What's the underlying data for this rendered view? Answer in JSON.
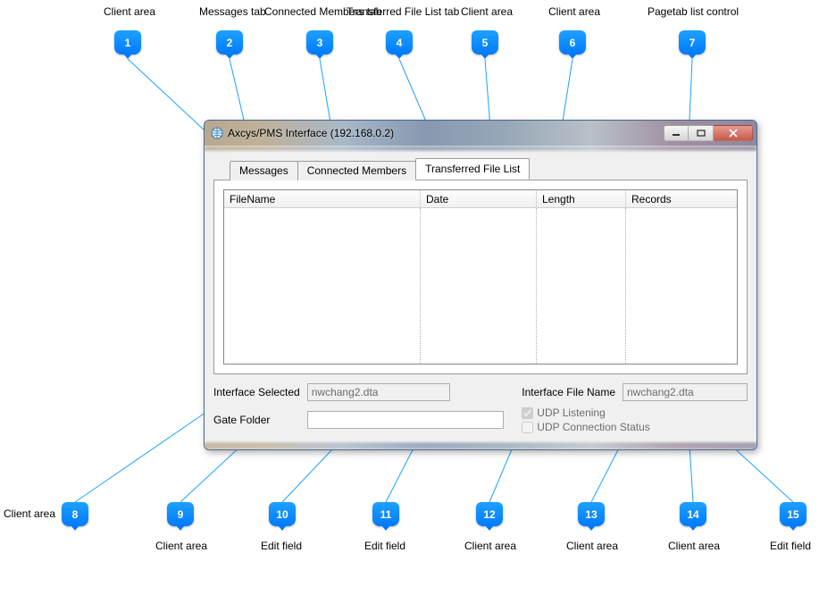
{
  "callouts": {
    "top": [
      {
        "n": "1",
        "label": "Client area"
      },
      {
        "n": "2",
        "label": "Messages tab"
      },
      {
        "n": "3",
        "label": "Connected Members tab"
      },
      {
        "n": "4",
        "label": "Transferred File List tab"
      },
      {
        "n": "5",
        "label": "Client area"
      },
      {
        "n": "6",
        "label": "Client area"
      },
      {
        "n": "7",
        "label": "Pagetab list control"
      }
    ],
    "bottom": [
      {
        "n": "8",
        "label": "Client area"
      },
      {
        "n": "9",
        "label": "Client area"
      },
      {
        "n": "10",
        "label": "Edit field"
      },
      {
        "n": "11",
        "label": "Edit field"
      },
      {
        "n": "12",
        "label": "Client area"
      },
      {
        "n": "13",
        "label": "Client area"
      },
      {
        "n": "14",
        "label": "Client area"
      },
      {
        "n": "15",
        "label": "Edit field"
      }
    ]
  },
  "window": {
    "title": "Axcys/PMS Interface (192.168.0.2)",
    "tabs": {
      "messages": "Messages",
      "connected": "Connected Members",
      "transferred": "Transferred File List"
    },
    "columns": {
      "filename": "FileName",
      "date": "Date",
      "length": "Length",
      "records": "Records"
    },
    "labels": {
      "interface_selected": "Interface Selected",
      "gate_folder": "Gate Folder",
      "interface_file_name": "Interface File Name",
      "udp_listening": "UDP Listening",
      "udp_conn_status": "UDP Connection Status"
    },
    "values": {
      "interface_selected": "nwchang2.dta",
      "gate_folder": "",
      "interface_file_name": "nwchang2.dta",
      "udp_listening_checked": true,
      "udp_conn_status_checked": false
    }
  }
}
